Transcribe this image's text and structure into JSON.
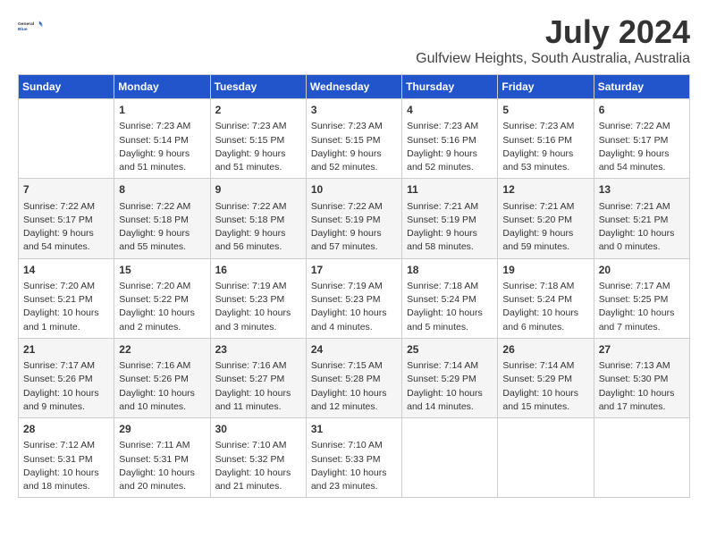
{
  "header": {
    "logo_general": "General",
    "logo_blue": "Blue",
    "title": "July 2024",
    "subtitle": "Gulfview Heights, South Australia, Australia"
  },
  "columns": [
    "Sunday",
    "Monday",
    "Tuesday",
    "Wednesday",
    "Thursday",
    "Friday",
    "Saturday"
  ],
  "weeks": [
    [
      {
        "day": "",
        "info": ""
      },
      {
        "day": "1",
        "info": "Sunrise: 7:23 AM\nSunset: 5:14 PM\nDaylight: 9 hours\nand 51 minutes."
      },
      {
        "day": "2",
        "info": "Sunrise: 7:23 AM\nSunset: 5:15 PM\nDaylight: 9 hours\nand 51 minutes."
      },
      {
        "day": "3",
        "info": "Sunrise: 7:23 AM\nSunset: 5:15 PM\nDaylight: 9 hours\nand 52 minutes."
      },
      {
        "day": "4",
        "info": "Sunrise: 7:23 AM\nSunset: 5:16 PM\nDaylight: 9 hours\nand 52 minutes."
      },
      {
        "day": "5",
        "info": "Sunrise: 7:23 AM\nSunset: 5:16 PM\nDaylight: 9 hours\nand 53 minutes."
      },
      {
        "day": "6",
        "info": "Sunrise: 7:22 AM\nSunset: 5:17 PM\nDaylight: 9 hours\nand 54 minutes."
      }
    ],
    [
      {
        "day": "7",
        "info": "Sunrise: 7:22 AM\nSunset: 5:17 PM\nDaylight: 9 hours\nand 54 minutes."
      },
      {
        "day": "8",
        "info": "Sunrise: 7:22 AM\nSunset: 5:18 PM\nDaylight: 9 hours\nand 55 minutes."
      },
      {
        "day": "9",
        "info": "Sunrise: 7:22 AM\nSunset: 5:18 PM\nDaylight: 9 hours\nand 56 minutes."
      },
      {
        "day": "10",
        "info": "Sunrise: 7:22 AM\nSunset: 5:19 PM\nDaylight: 9 hours\nand 57 minutes."
      },
      {
        "day": "11",
        "info": "Sunrise: 7:21 AM\nSunset: 5:19 PM\nDaylight: 9 hours\nand 58 minutes."
      },
      {
        "day": "12",
        "info": "Sunrise: 7:21 AM\nSunset: 5:20 PM\nDaylight: 9 hours\nand 59 minutes."
      },
      {
        "day": "13",
        "info": "Sunrise: 7:21 AM\nSunset: 5:21 PM\nDaylight: 10 hours\nand 0 minutes."
      }
    ],
    [
      {
        "day": "14",
        "info": "Sunrise: 7:20 AM\nSunset: 5:21 PM\nDaylight: 10 hours\nand 1 minute."
      },
      {
        "day": "15",
        "info": "Sunrise: 7:20 AM\nSunset: 5:22 PM\nDaylight: 10 hours\nand 2 minutes."
      },
      {
        "day": "16",
        "info": "Sunrise: 7:19 AM\nSunset: 5:23 PM\nDaylight: 10 hours\nand 3 minutes."
      },
      {
        "day": "17",
        "info": "Sunrise: 7:19 AM\nSunset: 5:23 PM\nDaylight: 10 hours\nand 4 minutes."
      },
      {
        "day": "18",
        "info": "Sunrise: 7:18 AM\nSunset: 5:24 PM\nDaylight: 10 hours\nand 5 minutes."
      },
      {
        "day": "19",
        "info": "Sunrise: 7:18 AM\nSunset: 5:24 PM\nDaylight: 10 hours\nand 6 minutes."
      },
      {
        "day": "20",
        "info": "Sunrise: 7:17 AM\nSunset: 5:25 PM\nDaylight: 10 hours\nand 7 minutes."
      }
    ],
    [
      {
        "day": "21",
        "info": "Sunrise: 7:17 AM\nSunset: 5:26 PM\nDaylight: 10 hours\nand 9 minutes."
      },
      {
        "day": "22",
        "info": "Sunrise: 7:16 AM\nSunset: 5:26 PM\nDaylight: 10 hours\nand 10 minutes."
      },
      {
        "day": "23",
        "info": "Sunrise: 7:16 AM\nSunset: 5:27 PM\nDaylight: 10 hours\nand 11 minutes."
      },
      {
        "day": "24",
        "info": "Sunrise: 7:15 AM\nSunset: 5:28 PM\nDaylight: 10 hours\nand 12 minutes."
      },
      {
        "day": "25",
        "info": "Sunrise: 7:14 AM\nSunset: 5:29 PM\nDaylight: 10 hours\nand 14 minutes."
      },
      {
        "day": "26",
        "info": "Sunrise: 7:14 AM\nSunset: 5:29 PM\nDaylight: 10 hours\nand 15 minutes."
      },
      {
        "day": "27",
        "info": "Sunrise: 7:13 AM\nSunset: 5:30 PM\nDaylight: 10 hours\nand 17 minutes."
      }
    ],
    [
      {
        "day": "28",
        "info": "Sunrise: 7:12 AM\nSunset: 5:31 PM\nDaylight: 10 hours\nand 18 minutes."
      },
      {
        "day": "29",
        "info": "Sunrise: 7:11 AM\nSunset: 5:31 PM\nDaylight: 10 hours\nand 20 minutes."
      },
      {
        "day": "30",
        "info": "Sunrise: 7:10 AM\nSunset: 5:32 PM\nDaylight: 10 hours\nand 21 minutes."
      },
      {
        "day": "31",
        "info": "Sunrise: 7:10 AM\nSunset: 5:33 PM\nDaylight: 10 hours\nand 23 minutes."
      },
      {
        "day": "",
        "info": ""
      },
      {
        "day": "",
        "info": ""
      },
      {
        "day": "",
        "info": ""
      }
    ]
  ]
}
